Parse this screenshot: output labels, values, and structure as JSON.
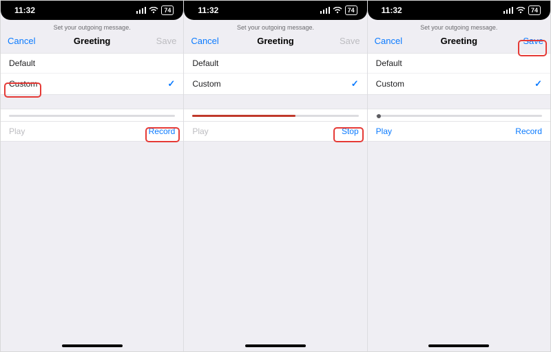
{
  "status": {
    "time": "11:32",
    "battery": "74"
  },
  "hint": "Set your outgoing message.",
  "nav": {
    "cancel": "Cancel",
    "title": "Greeting",
    "save": "Save"
  },
  "options": {
    "default": "Default",
    "custom": "Custom"
  },
  "controls": {
    "play": "Play",
    "record": "Record",
    "stop": "Stop"
  },
  "screens": [
    {
      "save_enabled": false,
      "progress": 0,
      "progress_dot": false,
      "play_enabled": false,
      "action": "record",
      "highlight": "custom_and_record"
    },
    {
      "save_enabled": false,
      "progress": 62,
      "progress_dot": false,
      "play_enabled": false,
      "action": "stop",
      "highlight": "stop"
    },
    {
      "save_enabled": true,
      "progress": 0,
      "progress_dot": true,
      "play_enabled": true,
      "action": "record",
      "highlight": "save"
    }
  ]
}
